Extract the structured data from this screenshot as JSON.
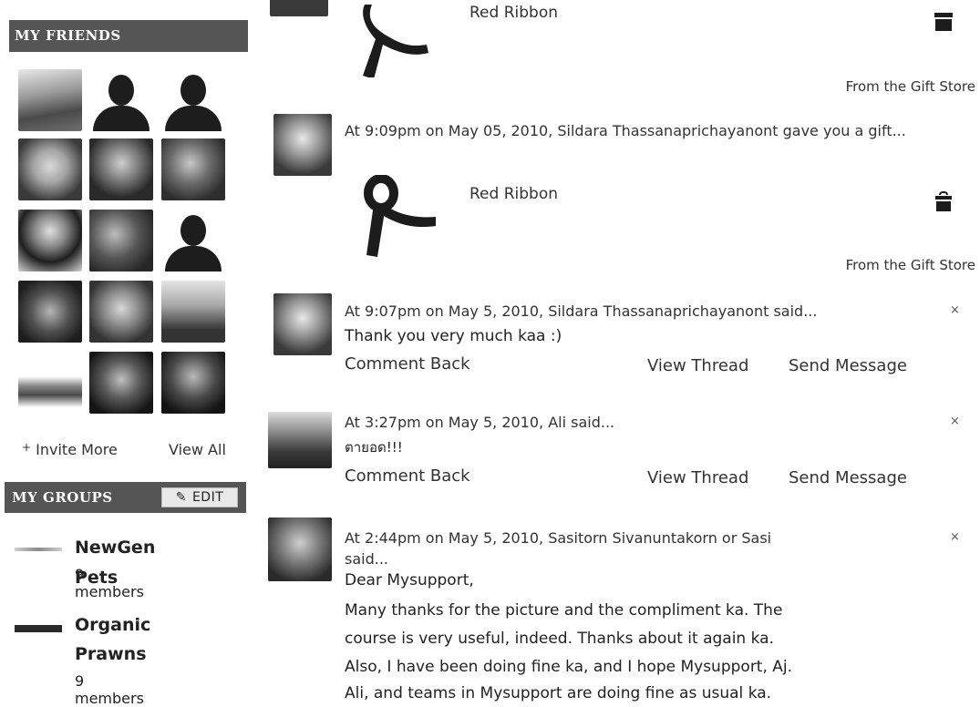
{
  "friends": {
    "header": "MY FRIENDS",
    "invite_more": "Invite More",
    "view_all": "View All"
  },
  "groups": {
    "header": "MY GROUPS",
    "edit_label": "EDIT",
    "items": [
      {
        "name": "NewGen Pets",
        "members": "9 members"
      },
      {
        "name_line1": "Organic",
        "name_line2": "Prawns",
        "members": "9 members"
      }
    ]
  },
  "feed": {
    "gift_top": {
      "name": "Red Ribbon",
      "source": "From the Gift Store"
    },
    "gift_post": {
      "text": "At 9:09pm on May 05, 2010, Sildara Thassanaprichayanont gave you a gift...",
      "gift_name": "Red Ribbon",
      "source": "From the Gift Store"
    },
    "comments": [
      {
        "header": "At 9:07pm on May 5, 2010, Sildara Thassanaprichayanont said...",
        "message": "Thank you very much kaa :)",
        "comment_back": "Comment Back",
        "view_thread": "View Thread",
        "send_message": "Send Message",
        "close": "×"
      },
      {
        "header": "At 3:27pm on May 5, 2010, Ali said...",
        "message": "ตายอด!!!",
        "comment_back": "Comment Back",
        "view_thread": "View Thread",
        "send_message": "Send Message",
        "close": "×"
      },
      {
        "header_line1": "At 2:44pm on May 5, 2010, Sasitorn Sivanuntakorn or Sasi",
        "header_line2": "said...",
        "greeting": "Dear Mysupport,",
        "body_lines": [
          "Many thanks for the picture and the compliment ka. The",
          "course is very useful, indeed. Thanks about it again ka.",
          "Also, I have been doing fine ka, and I hope Mysupport, Aj.",
          "Ali, and teams in Mysupport are doing fine as usual ka."
        ],
        "close": "×"
      }
    ]
  }
}
